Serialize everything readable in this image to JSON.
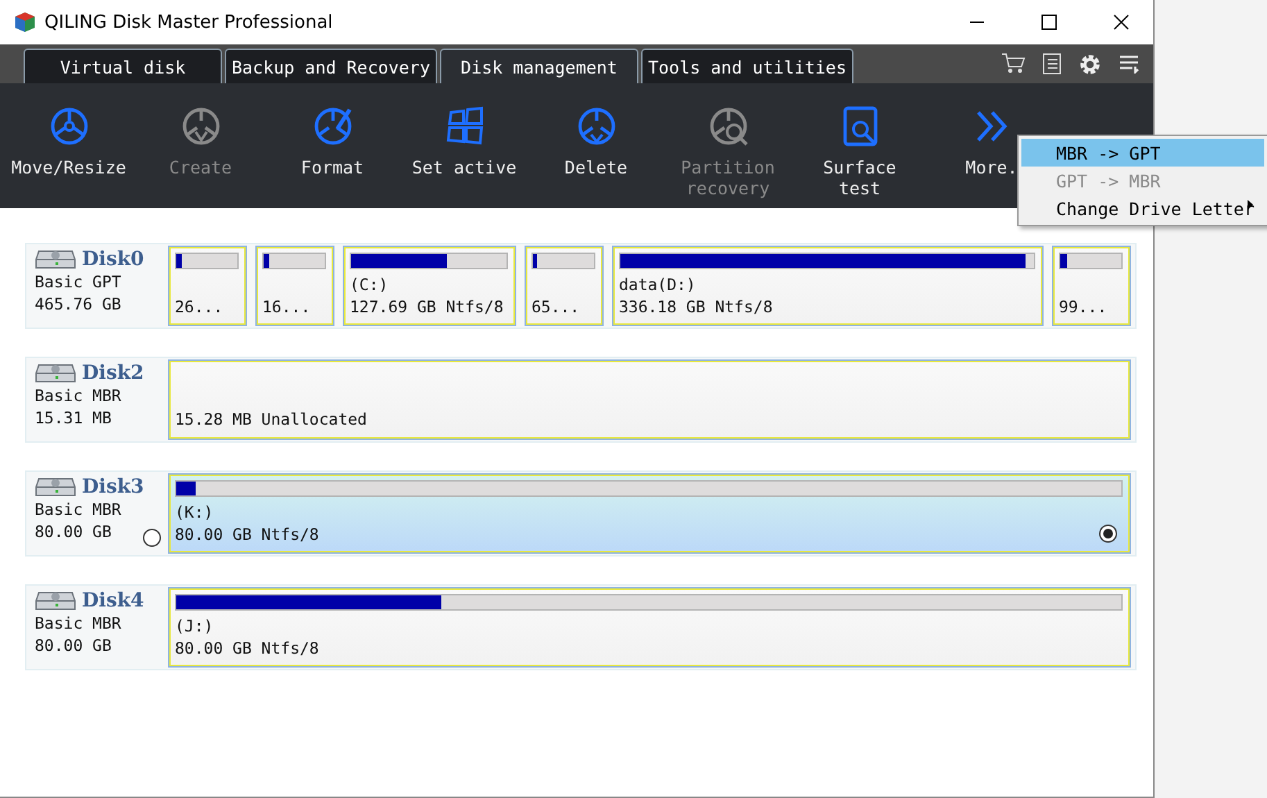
{
  "window": {
    "title": "QILING Disk Master Professional"
  },
  "tabs": [
    {
      "label": "Virtual disk",
      "selected": false
    },
    {
      "label": "Backup and Recovery",
      "selected": false
    },
    {
      "label": "Disk management",
      "selected": true
    },
    {
      "label": "Tools and utilities",
      "selected": false
    }
  ],
  "toolbar": [
    {
      "kind": "move",
      "label": "Move/Resize",
      "disabled": false
    },
    {
      "kind": "create",
      "label": "Create",
      "disabled": true
    },
    {
      "kind": "format",
      "label": "Format",
      "disabled": false
    },
    {
      "kind": "active",
      "label": "Set active",
      "disabled": false
    },
    {
      "kind": "delete",
      "label": "Delete",
      "disabled": false
    },
    {
      "kind": "recovery",
      "label": "Partition recovery",
      "disabled": true
    },
    {
      "kind": "surface",
      "label": "Surface test",
      "disabled": false
    },
    {
      "kind": "more",
      "label": "More.",
      "disabled": false
    }
  ],
  "menu": [
    {
      "label": "MBR -> GPT",
      "selected": true,
      "disabled": false,
      "submenu": false
    },
    {
      "label": "GPT -> MBR",
      "selected": false,
      "disabled": true,
      "submenu": false
    },
    {
      "label": "Change Drive Letter",
      "selected": false,
      "disabled": false,
      "submenu": true
    }
  ],
  "disks": [
    {
      "name": "Disk0",
      "type": "Basic GPT",
      "size": "465.76 GB",
      "partitions": [
        {
          "info": "26...",
          "level": 0.08,
          "selected": false,
          "kind": "small"
        },
        {
          "info": "16...",
          "level": 0.08,
          "selected": false,
          "kind": "small"
        },
        {
          "label": "(C:)",
          "info": "127.69 GB Ntfs/8",
          "level": 0.62,
          "selected": false,
          "kind": "used"
        },
        {
          "info": "65...",
          "level": 0.08,
          "selected": false,
          "kind": "small"
        },
        {
          "label": "data(D:)",
          "info": "336.18 GB Ntfs/8",
          "level": 0.98,
          "selected": false,
          "kind": "used"
        },
        {
          "info": "99...",
          "level": 0.12,
          "selected": false,
          "kind": "small"
        }
      ]
    },
    {
      "name": "Disk2",
      "type": "Basic MBR",
      "size": "15.31 MB",
      "partitions": [
        {
          "info": "15.28 MB Unallocated",
          "selected": false,
          "kind": "unallocated"
        }
      ]
    },
    {
      "name": "Disk3",
      "type": "Basic MBR",
      "size": "80.00 GB",
      "selected": false,
      "partitions": [
        {
          "label": "(K:)",
          "info": "80.00 GB Ntfs/8",
          "level": 0.02,
          "selected": true,
          "kind": "used"
        }
      ]
    },
    {
      "name": "Disk4",
      "type": "Basic MBR",
      "size": "80.00 GB",
      "partitions": [
        {
          "label": "(J:)",
          "info": "80.00 GB Ntfs/8",
          "level": 0.28,
          "selected": false,
          "kind": "used"
        }
      ]
    }
  ]
}
